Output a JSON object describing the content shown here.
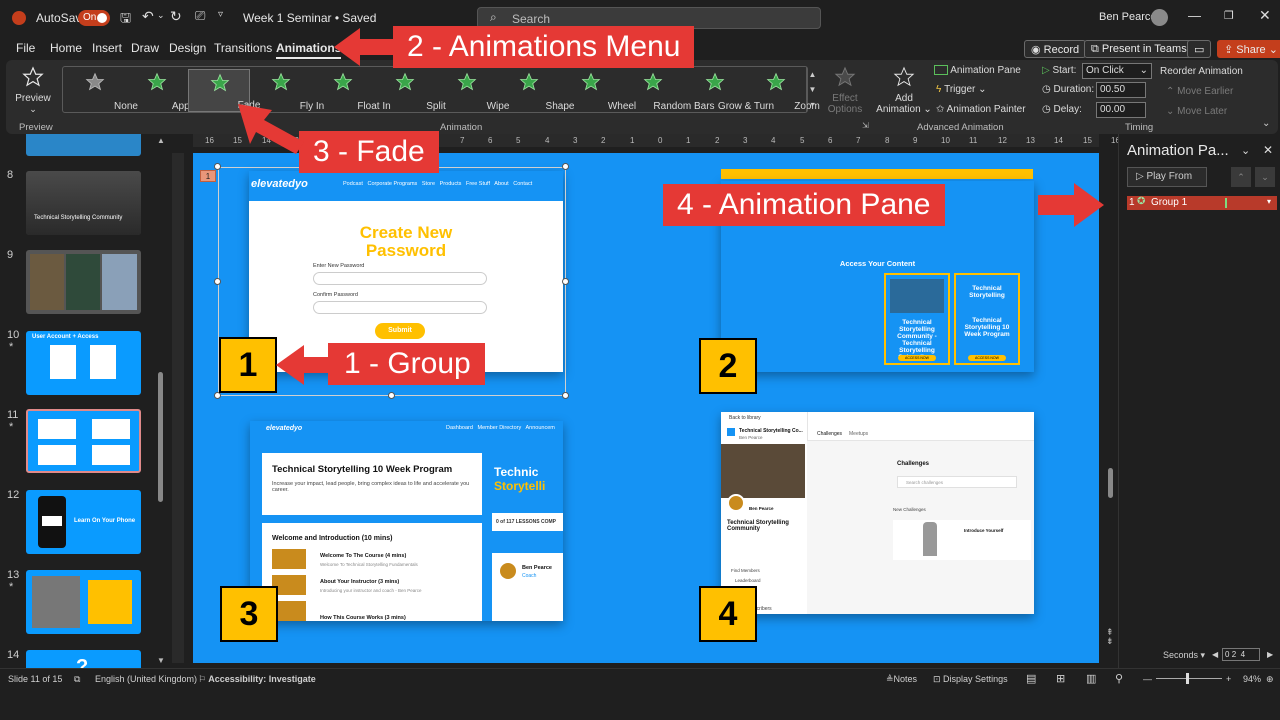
{
  "titlebar": {
    "autosave_label": "AutoSave",
    "autosave_state": "On",
    "doc_title": "Week 1 Seminar • Saved",
    "search_placeholder": "Search",
    "user_name": "Ben Pearce"
  },
  "menu": {
    "items": [
      "File",
      "Home",
      "Insert",
      "Draw",
      "Design",
      "Transitions",
      "Animations"
    ],
    "active": "Animations",
    "record": "Record",
    "present": "Present in Teams",
    "share": "Share"
  },
  "ribbon": {
    "preview": "Preview",
    "preview_group": "Preview",
    "animations": [
      "None",
      "Appear",
      "Fade",
      "Fly In",
      "Float In",
      "Split",
      "Wipe",
      "Shape",
      "Wheel",
      "Random Bars",
      "Grow & Turn",
      "Zoom"
    ],
    "effect_options_1": "Effect",
    "effect_options_2": "Options",
    "animation_group": "Animation",
    "add_animation_1": "Add",
    "add_animation_2": "Animation",
    "animation_pane": "Animation Pane",
    "trigger": "Trigger",
    "animation_painter": "Animation Painter",
    "advanced_group": "Advanced Animation",
    "start_label": "Start:",
    "start_value": "On Click",
    "duration_label": "Duration:",
    "duration_value": "00.50",
    "delay_label": "Delay:",
    "delay_value": "00.00",
    "reorder": "Reorder Animation",
    "move_earlier": "Move Earlier",
    "move_later": "Move Later",
    "timing_group": "Timing"
  },
  "ruler": {
    "marks": [
      "16",
      "15",
      "14",
      "13",
      "12",
      "11",
      "10",
      "9",
      "8",
      "7",
      "6",
      "5",
      "4",
      "3",
      "2",
      "1",
      "0",
      "1",
      "2",
      "3",
      "4",
      "5",
      "6",
      "7",
      "8",
      "9",
      "10",
      "11",
      "12",
      "13",
      "14",
      "15",
      "16"
    ]
  },
  "thumbnails": {
    "numbers": [
      "8",
      "9",
      "10",
      "11",
      "12",
      "13",
      "14"
    ],
    "slide8_text": "Technical Storytelling Community",
    "slide10_text": "User Account + Access",
    "slide12_text": "Learn On Your Phone",
    "slide14_text": "?"
  },
  "slide": {
    "card1": {
      "brand": "elevatedyo",
      "nav": [
        "Podcast",
        "Corporate Programs",
        "Store",
        "Products",
        "Free Stuff",
        "About",
        "Contact"
      ],
      "heading_1": "Create New",
      "heading_2": "Password",
      "label_new": "Enter New Password",
      "label_confirm": "Confirm Password",
      "submit": "Submit"
    },
    "card2": {
      "access_title": "Access Your Content",
      "tile1": "Technical Storytelling Community - Technical Storytelling Subscribers",
      "tile2": "Technical Storytelling 10 Week Program",
      "tile_header": "Technical Storytelling",
      "btn": "ACCESS NOW"
    },
    "card3": {
      "brand": "elevatedyo",
      "nav": [
        "Dashboard",
        "Member Directory",
        "Announcem"
      ],
      "program_title": "Technical Storytelling 10 Week Program",
      "program_sub": "Increase your impact, lead people, bring complex ideas to life and accelerate you career.",
      "banner_1": "Technic",
      "banner_2": "Storytelli",
      "progress": "0 of 117 LESSONS COMP",
      "section": "Welcome and Introduction (10 mins)",
      "lesson1": "Welcome To The Course (4 mins)",
      "lesson1_sub": "Welcome To Technical Storytelling Fundamentals",
      "lesson2": "About Your Instructor (3 mins)",
      "lesson2_sub": "Introducing your instructor and coach - Ben Pearce",
      "lesson3": "How This Course Works (3 mins)",
      "coach_name": "Ben Pearce",
      "coach_role": "Coach"
    },
    "card4": {
      "back": "Back to library",
      "group_name": "Technical Storytelling Co...",
      "owner": "Ben Pearce",
      "tabs": [
        "Challenges",
        "Meetups"
      ],
      "community_title": "Technical Storytelling Community",
      "challenges": "Challenges",
      "search": "Search challenges",
      "new_challenges": "New Challenges",
      "intro_title": "Introduce Yourself",
      "find_members": "Find Members",
      "leaderboard": "Leaderboard",
      "subscribers": "lling Subscribers"
    },
    "numbers": [
      "1",
      "2",
      "3",
      "4"
    ],
    "anim_tag": "1"
  },
  "callouts": {
    "c1": "1 - Group",
    "c2": "2 - Animations Menu",
    "c3": "3 - Fade",
    "c4": "4 - Animation Pane"
  },
  "animation_pane": {
    "title": "Animation Pa...",
    "play_from": "Play From",
    "item_index": "1",
    "item_label": "Group 1",
    "seconds": "Seconds",
    "scale": [
      "0",
      "2",
      "4"
    ]
  },
  "statusbar": {
    "slide": "Slide 11 of 15",
    "language": "English (United Kingdom)",
    "accessibility": "Accessibility: Investigate",
    "notes": "Notes",
    "display": "Display Settings",
    "zoom": "94%"
  },
  "colors": {
    "accent": "#c43e1c",
    "slide_bg": "#1593f4",
    "callout": "#e53935",
    "number_box": "#ffc000",
    "brand_yellow": "#ffc000"
  }
}
